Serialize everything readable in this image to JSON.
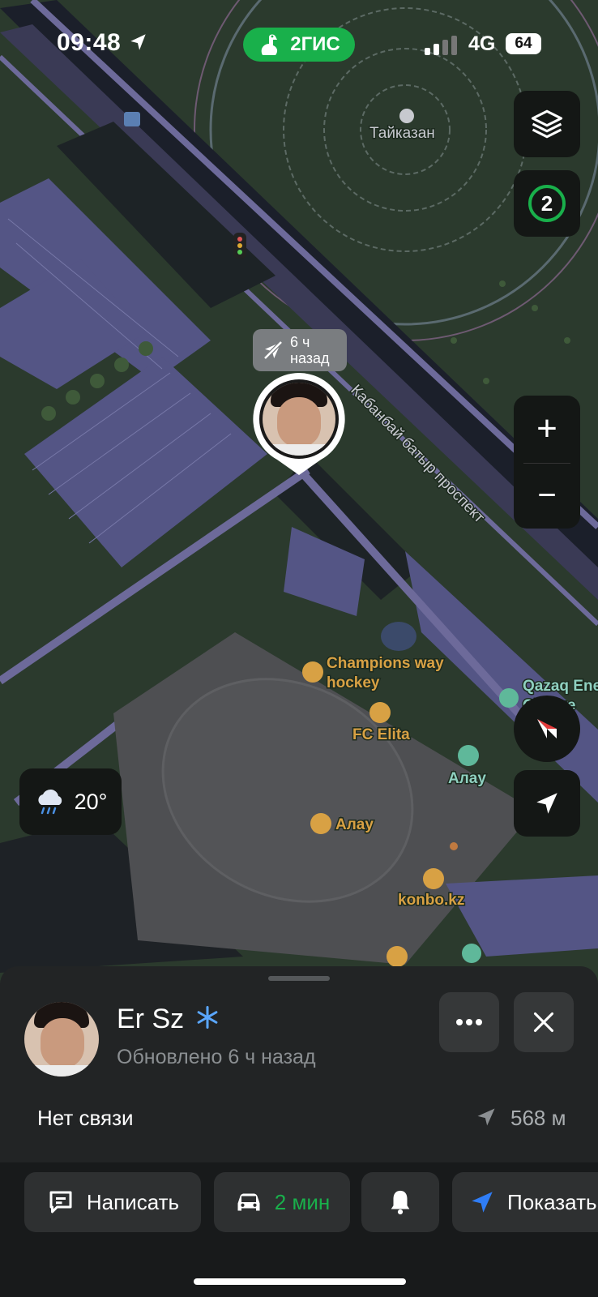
{
  "status_bar": {
    "time": "09:48",
    "network": "4G",
    "battery": "64"
  },
  "app": {
    "brand": "2ГИС"
  },
  "controls": {
    "friends_count": "2",
    "zoom_in": "+",
    "zoom_out": "−"
  },
  "weather": {
    "temperature": "20°"
  },
  "marker": {
    "last_seen_line1": "6 ч",
    "last_seen_line2": "назад"
  },
  "map_labels": {
    "tajkazan": "Тайказан",
    "street": "Кабанбай батыр проспект",
    "champions_line1": "Champions way",
    "champions_line2": "hockey",
    "fc_elita": "FC Elita",
    "alau_hotel": "Алау",
    "alau_rink": "Алау",
    "konbo": "konbo.kz",
    "qazaq_line1": "Qazaq Ene",
    "qazaq_line2": "Charge"
  },
  "sheet": {
    "name": "Er Sz",
    "updated": "Обновлено 6 ч назад",
    "connection_status": "Нет связи",
    "distance": "568 м"
  },
  "actions": {
    "message": "Написать",
    "drive_time": "2 мин",
    "show": "Показать"
  },
  "colors": {
    "accent_green": "#19b04b",
    "map_water_park": "#2c3a2e",
    "route_label": "#d8a144"
  }
}
